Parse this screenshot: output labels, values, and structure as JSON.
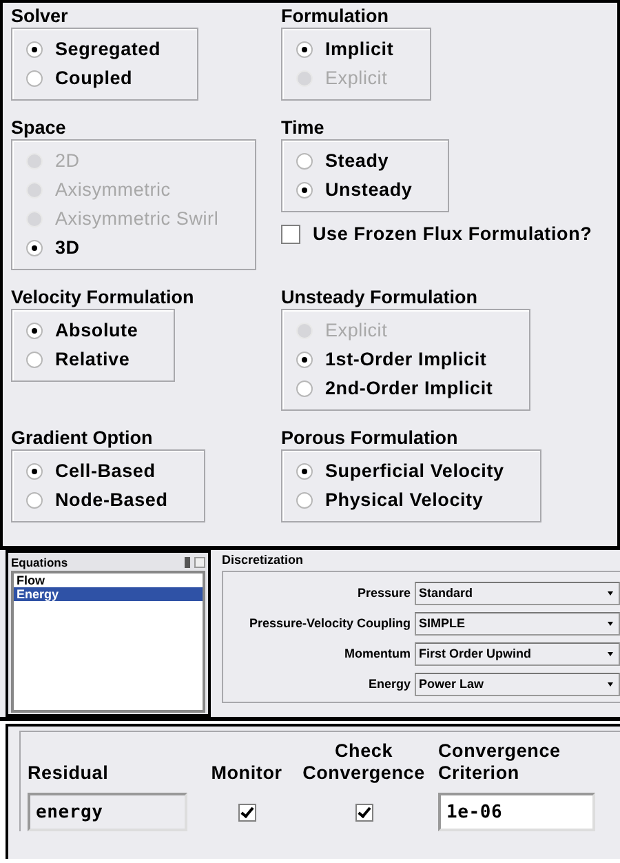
{
  "options_panel": {
    "rows": [
      {
        "left": [
          {
            "kind": "radio-group",
            "title": "Solver",
            "options": [
              {
                "label": "Segregated",
                "selected": true,
                "disabled": false
              },
              {
                "label": "Coupled",
                "selected": false,
                "disabled": false
              }
            ]
          }
        ],
        "right": [
          {
            "kind": "radio-group",
            "title": "Formulation",
            "options": [
              {
                "label": "Implicit",
                "selected": true,
                "disabled": false
              },
              {
                "label": "Explicit",
                "selected": false,
                "disabled": true
              }
            ]
          }
        ]
      },
      {
        "left": [
          {
            "kind": "radio-group",
            "title": "Space",
            "options": [
              {
                "label": "2D",
                "selected": false,
                "disabled": true
              },
              {
                "label": "Axisymmetric",
                "selected": false,
                "disabled": true
              },
              {
                "label": "Axisymmetric Swirl",
                "selected": false,
                "disabled": true
              },
              {
                "label": "3D",
                "selected": true,
                "disabled": false
              }
            ]
          }
        ],
        "right": [
          {
            "kind": "radio-group",
            "title": "Time",
            "options": [
              {
                "label": "Steady",
                "selected": false,
                "disabled": false
              },
              {
                "label": "Unsteady",
                "selected": true,
                "disabled": false
              }
            ]
          },
          {
            "kind": "checkbox",
            "label": "Use Frozen Flux Formulation?",
            "checked": false
          }
        ]
      },
      {
        "left": [
          {
            "kind": "radio-group",
            "title": "Velocity Formulation",
            "options": [
              {
                "label": "Absolute",
                "selected": true,
                "disabled": false
              },
              {
                "label": "Relative",
                "selected": false,
                "disabled": false
              }
            ]
          }
        ],
        "right": [
          {
            "kind": "radio-group",
            "title": "Unsteady Formulation",
            "options": [
              {
                "label": "Explicit",
                "selected": false,
                "disabled": true
              },
              {
                "label": "1st-Order Implicit",
                "selected": true,
                "disabled": false
              },
              {
                "label": "2nd-Order Implicit",
                "selected": false,
                "disabled": false
              }
            ]
          }
        ]
      },
      {
        "left": [
          {
            "kind": "radio-group",
            "title": "Gradient Option",
            "options": [
              {
                "label": "Cell-Based",
                "selected": true,
                "disabled": false
              },
              {
                "label": "Node-Based",
                "selected": false,
                "disabled": false
              }
            ]
          }
        ],
        "right": [
          {
            "kind": "radio-group",
            "title": "Porous Formulation",
            "options": [
              {
                "label": "Superficial Velocity",
                "selected": true,
                "disabled": false
              },
              {
                "label": "Physical Velocity",
                "selected": false,
                "disabled": false
              }
            ]
          }
        ]
      }
    ]
  },
  "equations": {
    "title": "Equations",
    "items": [
      {
        "label": "Flow",
        "selected": false
      },
      {
        "label": "Energy",
        "selected": true
      }
    ]
  },
  "discretization": {
    "title": "Discretization",
    "rows": [
      {
        "label": "Pressure",
        "value": "Standard"
      },
      {
        "label": "Pressure-Velocity Coupling",
        "value": "SIMPLE"
      },
      {
        "label": "Momentum",
        "value": "First Order Upwind"
      },
      {
        "label": "Energy",
        "value": "Power Law"
      }
    ]
  },
  "residuals": {
    "columns": [
      "Residual",
      "Monitor",
      "Check Convergence",
      "Convergence Criterion"
    ],
    "rows": [
      {
        "residual": "energy",
        "monitor": true,
        "check_convergence": true,
        "criterion": "1e-06"
      }
    ]
  }
}
